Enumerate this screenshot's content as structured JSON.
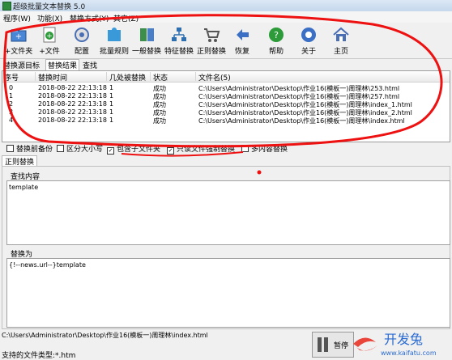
{
  "window": {
    "title": "超级批量文本替换 5.0"
  },
  "menu": [
    "程序(W)",
    "功能(X)",
    "替换方式(Y)",
    "其它(Z)"
  ],
  "toolbar": [
    {
      "label": "+文件夹",
      "icon": "add-folder-icon",
      "color": "#3a7bd5"
    },
    {
      "label": "+文件",
      "icon": "add-file-icon",
      "color": "#2e9b3a"
    },
    {
      "label": "配置",
      "icon": "config-icon",
      "color": "#4a6fb5"
    },
    {
      "label": "批量规则",
      "icon": "puzzle-icon",
      "color": "#3a9ad9"
    },
    {
      "label": "一般替换",
      "icon": "replace-icon",
      "color": "#3c8f4a"
    },
    {
      "label": "特征替换",
      "icon": "network-icon",
      "color": "#2f6fb0"
    },
    {
      "label": "正则替换",
      "icon": "cart-icon",
      "color": "#555555"
    },
    {
      "label": "恢复",
      "icon": "back-arrow-icon",
      "color": "#3a6fc5"
    },
    {
      "label": "帮助",
      "icon": "help-icon",
      "color": "#2e9b3a"
    },
    {
      "label": "关于",
      "icon": "about-icon",
      "color": "#3a6fc5"
    },
    {
      "label": "主页",
      "icon": "home-icon",
      "color": "#4a6fb5"
    }
  ],
  "tabs": [
    "替换源目标",
    "替换结果",
    "查找"
  ],
  "table": {
    "headers": [
      "序号",
      "替换时间",
      "几处被替换",
      "状态",
      "文件名(5)"
    ],
    "rows": [
      [
        "0",
        "2018-08-22 22:13:18",
        "1",
        "成功",
        "C:\\Users\\Administrator\\Desktop\\作业16(模板一)周理林\\253.html"
      ],
      [
        "1",
        "2018-08-22 22:13:18",
        "1",
        "成功",
        "C:\\Users\\Administrator\\Desktop\\作业16(模板一)周理林\\257.html"
      ],
      [
        "2",
        "2018-08-22 22:13:18",
        "1",
        "成功",
        "C:\\Users\\Administrator\\Desktop\\作业16(模板一)周理林\\index_1.html"
      ],
      [
        "3",
        "2018-08-22 22:13:18",
        "1",
        "成功",
        "C:\\Users\\Administrator\\Desktop\\作业16(模板一)周理林\\index_2.html"
      ],
      [
        "4",
        "2018-08-22 22:13:18",
        "1",
        "成功",
        "C:\\Users\\Administrator\\Desktop\\作业16(模板一)周理林\\index.html"
      ]
    ]
  },
  "options": [
    {
      "label": "替换前备份",
      "checked": false
    },
    {
      "label": "区分大小写",
      "checked": false
    },
    {
      "label": "包含子文件夹",
      "checked": true
    },
    {
      "label": "只读文件强制替换",
      "checked": true
    },
    {
      "label": "多内容替换",
      "checked": false
    }
  ],
  "regex_tab": "正则替换",
  "find_label": "查找内容",
  "find_value": "template",
  "replace_label": "替换为",
  "replace_value": "{!--news.url--}template",
  "status_path": "C:\\Users\\Administrator\\Desktop\\作业16(模板一)周理林\\index.html",
  "status_types": "支持的文件类型:*.htm",
  "pause_label": "暂停",
  "watermark": {
    "brand": "开发兔",
    "url": "www.kaifatu.com"
  },
  "annotation_color": "#ee1111"
}
